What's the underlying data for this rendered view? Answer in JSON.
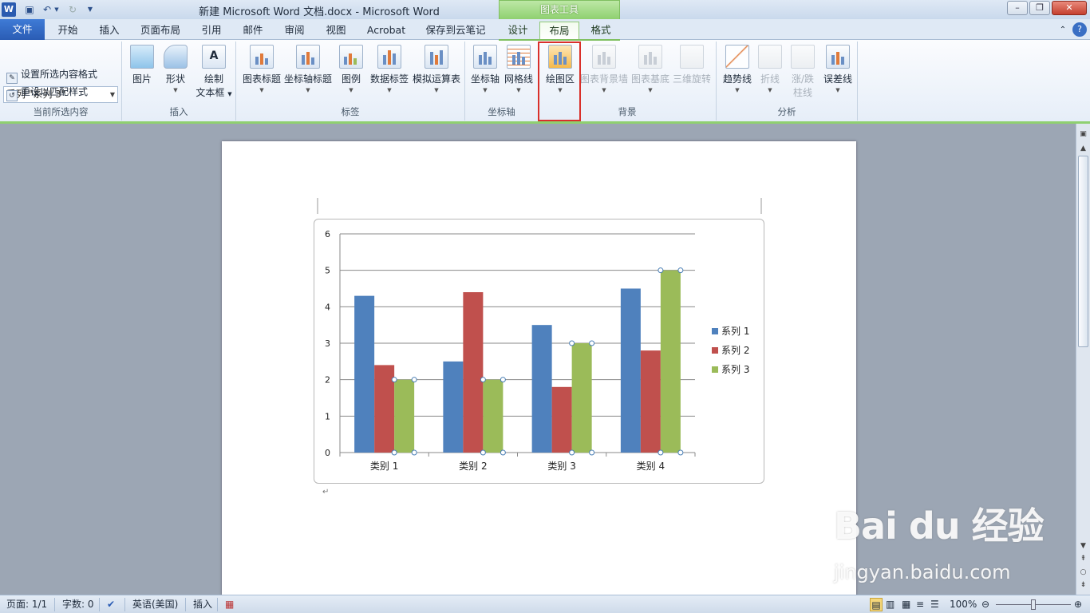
{
  "window": {
    "title": "新建 Microsoft Word 文档.docx - Microsoft Word",
    "context_group": "图表工具"
  },
  "qat": {
    "app_icon": "W",
    "save_icon": "save-icon",
    "undo_icon": "undo-icon",
    "redo_icon": "redo-icon"
  },
  "tabs": [
    "文件",
    "开始",
    "插入",
    "页面布局",
    "引用",
    "邮件",
    "审阅",
    "视图",
    "Acrobat",
    "保存到云笔记",
    "设计",
    "布局",
    "格式"
  ],
  "active_tab": "布局",
  "ribbon": {
    "current_selection": {
      "dropdown_value": "系列 \"系列 3\"",
      "format_selection": "设置所选内容格式",
      "reset_style": "重设以匹配样式",
      "label": "当前所选内容"
    },
    "insert": {
      "picture": "图片",
      "shapes": "形状",
      "textbox_line1": "绘制",
      "textbox_line2": "文本框",
      "label": "插入"
    },
    "labels": {
      "chart_title": "图表标题",
      "axis_titles": "坐标轴标题",
      "legend": "图例",
      "data_labels": "数据标签",
      "data_table": "模拟运算表",
      "label": "标签"
    },
    "axes": {
      "axes": "坐标轴",
      "gridlines": "网格线",
      "label": "坐标轴"
    },
    "background": {
      "plot_area": "绘图区",
      "chart_wall": "图表背景墙",
      "chart_floor": "图表基底",
      "rotation": "三维旋转",
      "label": "背景"
    },
    "analysis": {
      "trendline": "趋势线",
      "lines": "折线",
      "updown_line1": "涨/跌",
      "updown_line2": "柱线",
      "error_bars": "误差线",
      "label": "分析"
    }
  },
  "chart_data": {
    "type": "bar",
    "categories": [
      "类别 1",
      "类别 2",
      "类别 3",
      "类别 4"
    ],
    "series": [
      {
        "name": "系列 1",
        "values": [
          4.3,
          2.5,
          3.5,
          4.5
        ],
        "color": "#4f81bd"
      },
      {
        "name": "系列 2",
        "values": [
          2.4,
          4.4,
          1.8,
          2.8
        ],
        "color": "#c0504d"
      },
      {
        "name": "系列 3",
        "values": [
          2.0,
          2.0,
          3.0,
          5.0
        ],
        "color": "#9bbb59"
      }
    ],
    "ylim": [
      0,
      6
    ],
    "yticks": [
      0,
      1,
      2,
      3,
      4,
      5,
      6
    ],
    "grid": true,
    "legend": "right",
    "selected_series": "系列 3"
  },
  "statusbar": {
    "page": "页面: 1/1",
    "words": "字数: 0",
    "language": "英语(美国)",
    "mode": "插入",
    "zoom": "100%"
  },
  "watermark": {
    "logo": "Bai du 经验",
    "url": "jingyan.baidu.com"
  }
}
